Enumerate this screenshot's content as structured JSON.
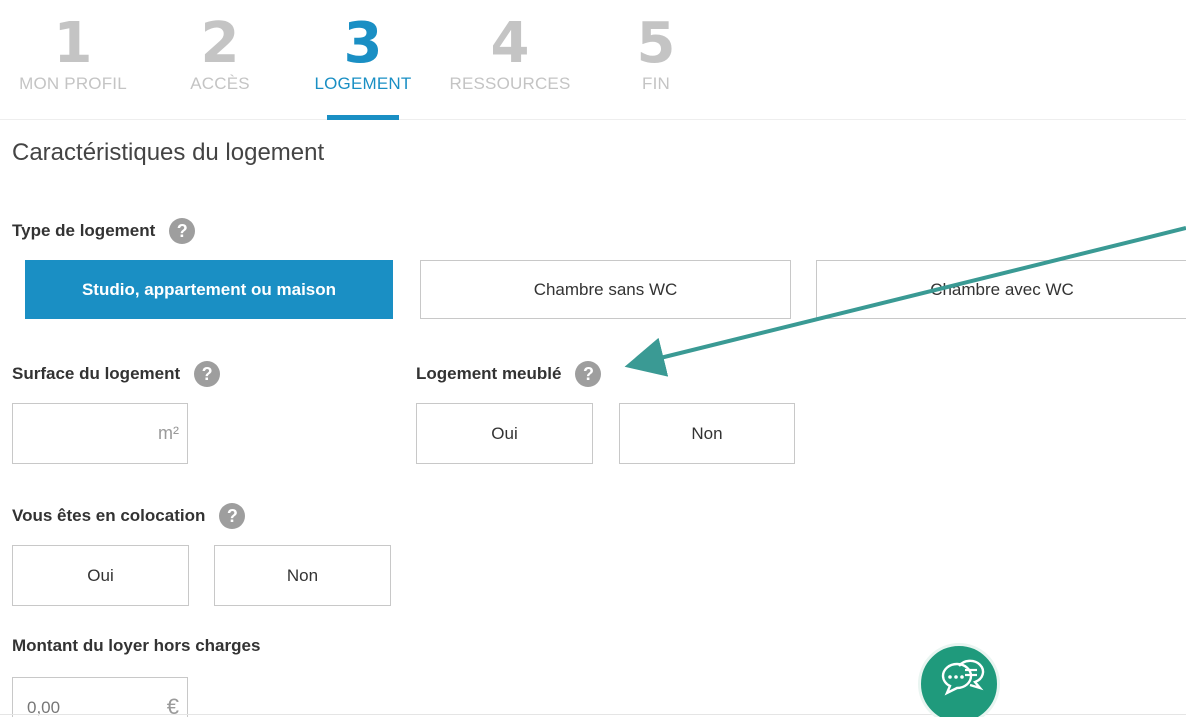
{
  "steps": [
    {
      "number": "1",
      "label": "MON PROFIL"
    },
    {
      "number": "2",
      "label": "ACCÈS"
    },
    {
      "number": "3",
      "label": "LOGEMENT"
    },
    {
      "number": "4",
      "label": "RESSOURCES"
    },
    {
      "number": "5",
      "label": "FIN"
    }
  ],
  "active_step": "3",
  "section_title": "Caractéristiques du logement",
  "type_logement": {
    "label": "Type de logement",
    "options": [
      "Studio, appartement ou maison",
      "Chambre sans WC",
      "Chambre avec WC"
    ],
    "selected": "Studio, appartement ou maison"
  },
  "surface": {
    "label": "Surface du logement",
    "unit": "m²",
    "value": ""
  },
  "meuble": {
    "label": "Logement meublé",
    "options": [
      "Oui",
      "Non"
    ]
  },
  "colocation": {
    "label": "Vous êtes en colocation",
    "options": [
      "Oui",
      "Non"
    ]
  },
  "loyer": {
    "label": "Montant du loyer hors charges",
    "placeholder": "0,00",
    "unit": "€"
  },
  "help_icon_glyph": "?",
  "colors": {
    "accent": "#1a8fc4",
    "chat": "#1f9a7c",
    "annotation_arrow": "#3a9a94"
  }
}
